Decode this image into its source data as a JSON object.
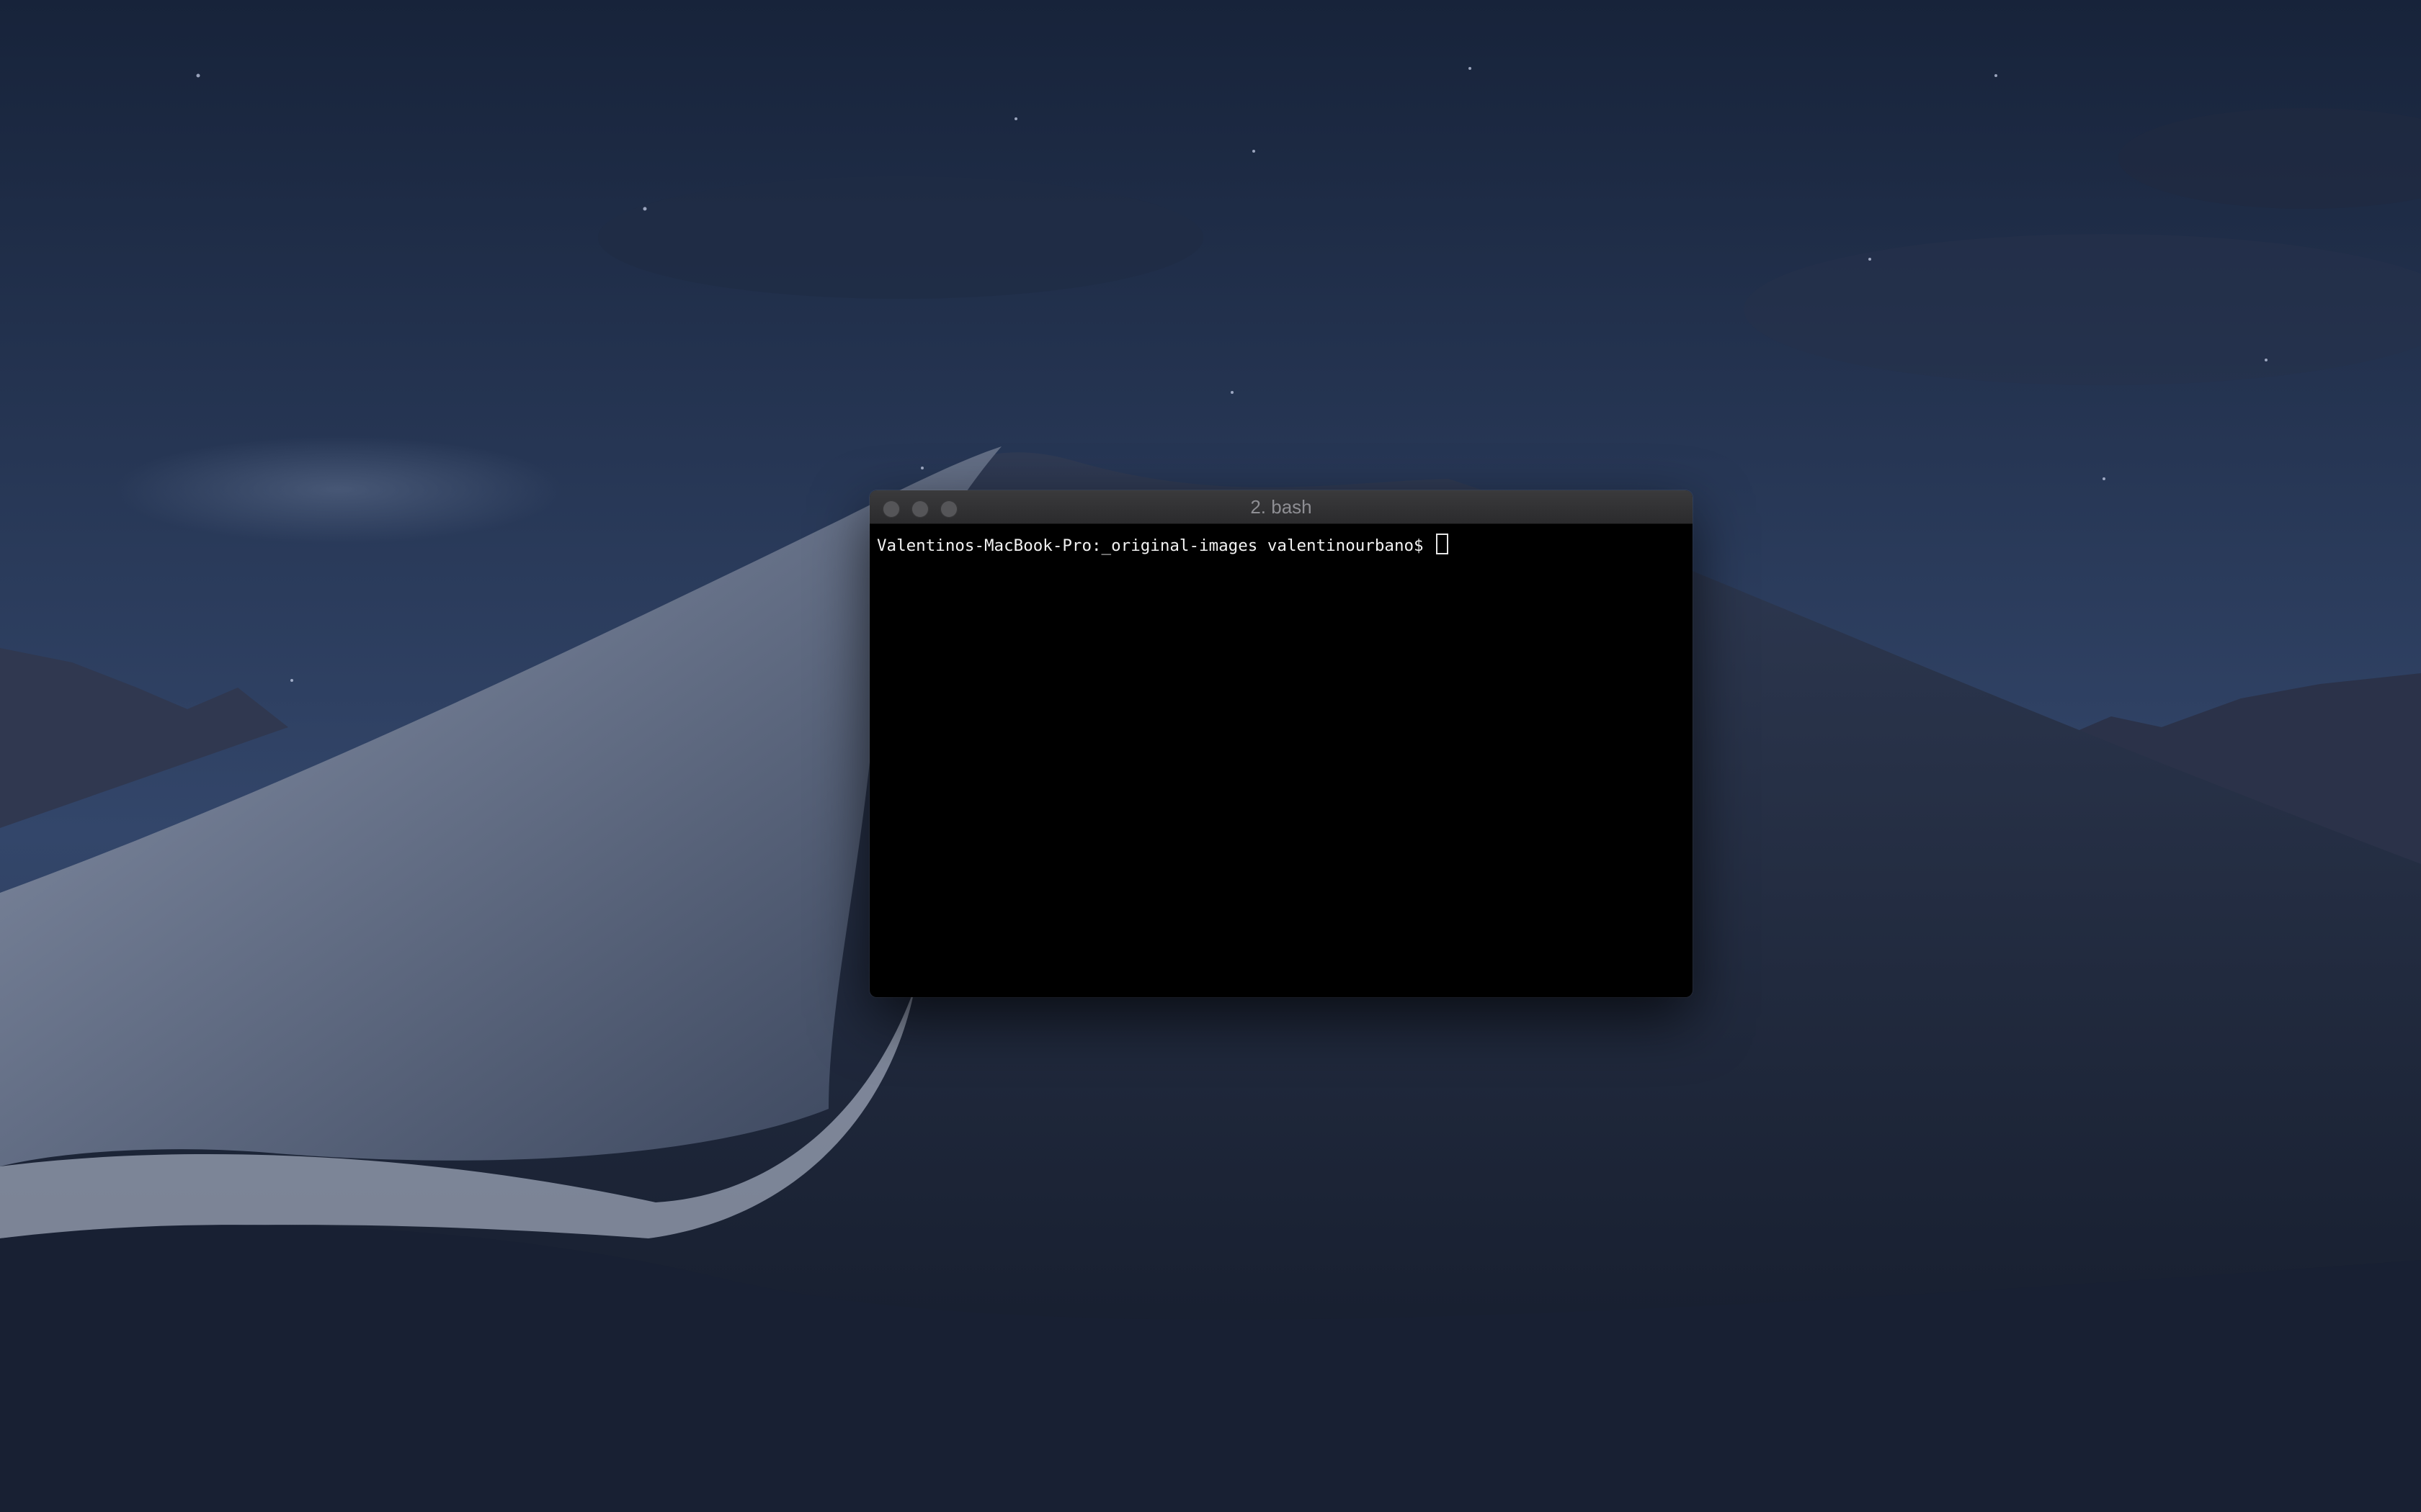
{
  "window": {
    "title": "2. bash",
    "prompt": "Valentinos-MacBook-Pro:_original-images valentinourbano$ "
  },
  "icons": {
    "close": "close-icon",
    "minimize": "minimize-icon",
    "zoom": "zoom-icon",
    "cursor": "cursor-icon"
  },
  "colors": {
    "terminal_background": "#000000",
    "text": "#f2f2f2",
    "titlebar": "#2f2f31"
  }
}
